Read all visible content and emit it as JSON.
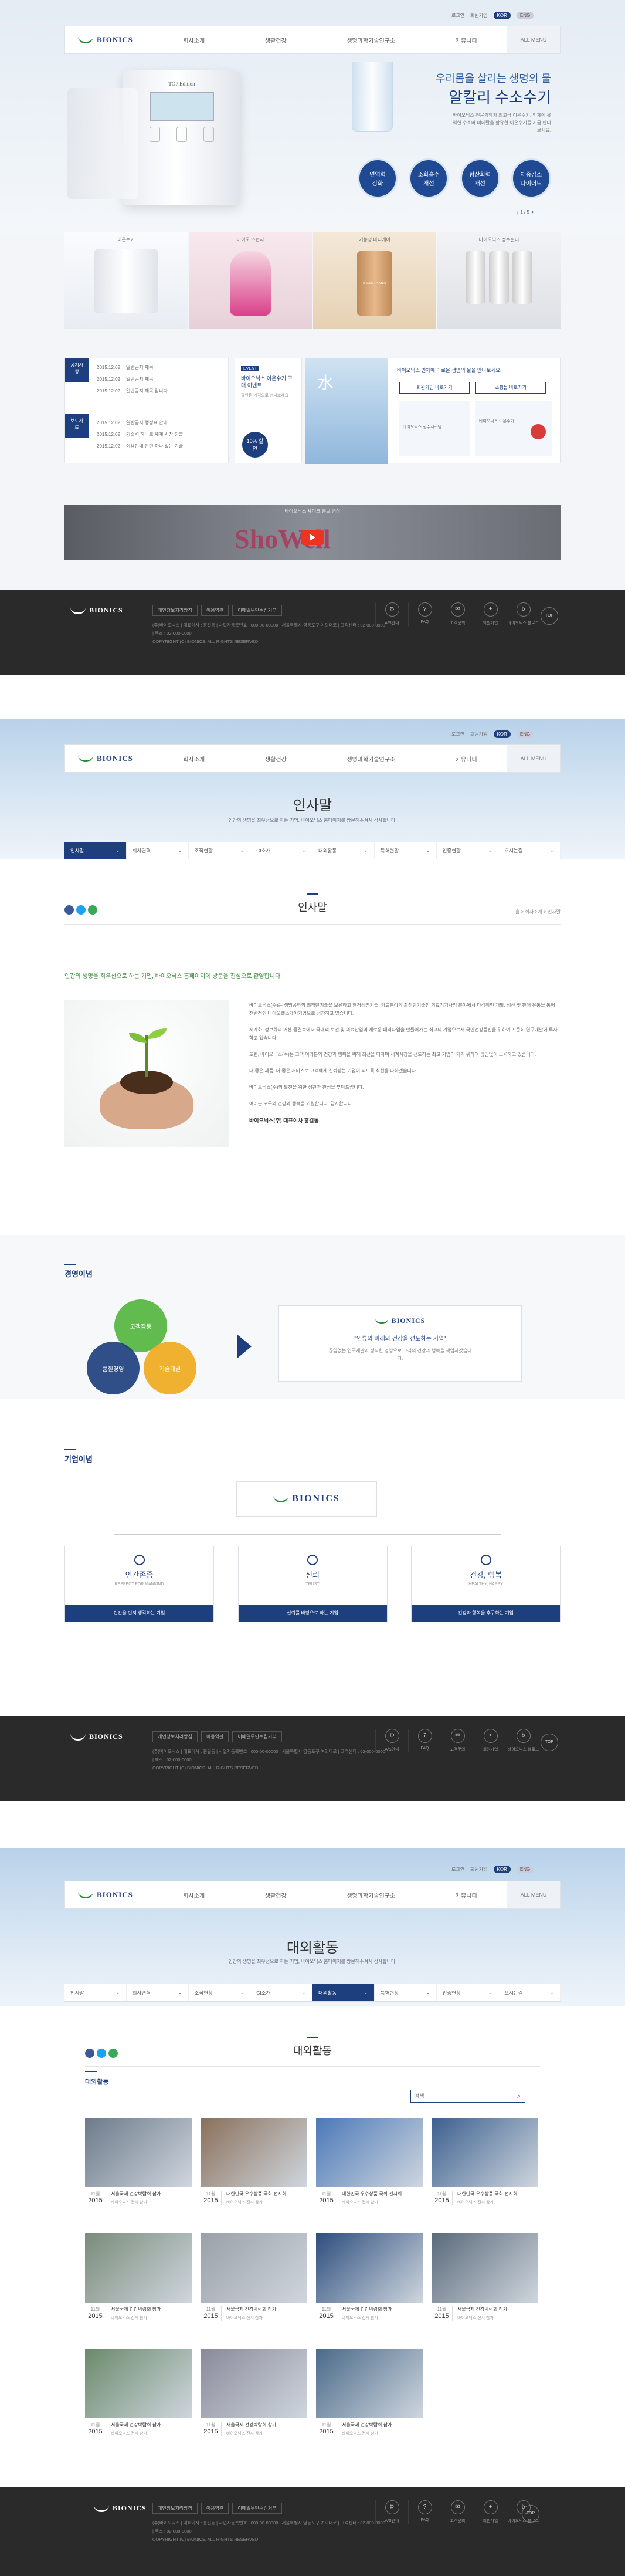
{
  "header": {
    "logo": "BIONICS",
    "nav": [
      "회사소개",
      "생활건강",
      "생명과학기술연구소",
      "커뮤니티"
    ],
    "all_menu": "ALL MENU",
    "util": [
      "로그인",
      "회원가입"
    ],
    "lang": [
      "KOR",
      "ENG"
    ]
  },
  "main": {
    "hero": {
      "tagline": "우리몸을 살리는 생명의 물",
      "title": "알칼리 수소수기",
      "desc": "바이오닉스 전문의학가 최고급 이온수기, 인체에 유익한 수소와 미네랄을 함유한 이온수기를 지금 만나보세요.",
      "device_label": "TOP Edition",
      "badges": [
        "면역력 강화",
        "소화흡수 개선",
        "항산화력 개선",
        "체중감소 다이어트"
      ],
      "pager": "1 / 5"
    },
    "products": [
      "이온수기",
      "바이오 스펀지",
      "기능성 바디케어",
      "바이오닉스 정수필터"
    ],
    "product_brand": "BEAUTAMIN",
    "notice": {
      "label1": "공지사항",
      "label2": "보도자료",
      "rows": [
        [
          "2015.12.02",
          "일반공지 제목"
        ],
        [
          "2015.12.02",
          "일반공지 제목"
        ],
        [
          "2015.12.02",
          "일반공지 제목 입니다"
        ],
        [
          "2015.12.02",
          "일반공지 행정표 안내"
        ],
        [
          "2015.12.02",
          "기술력 하나로 세계 시장 진출"
        ],
        [
          "2015.12.02",
          "이용안내 관련 하나 있는 기술"
        ]
      ]
    },
    "event": {
      "tag": "EVENT",
      "title": "바이오닉스 이온수기 구매 이벤트",
      "sub": "할인된 가격으로 만나보세요",
      "discount": "10% 할인"
    },
    "water": {
      "glyph": "水",
      "text": "바이오닉스 인체에 이로운 생명의 물을 만나보세요.",
      "btn1": "회원가입 바로가기",
      "btn2": "쇼핑몰 바로가기",
      "left_caption": "바이오닉스 정수시스템",
      "right_caption": "바이오닉스 이온수기"
    },
    "banner": {
      "caption": "바이오닉스 셰이크 홍보 영상",
      "brand": "ShoWell"
    }
  },
  "footer": {
    "logo": "BIONICS",
    "links": [
      "개인정보처리방침",
      "이용약관",
      "이메일무단수집거부"
    ],
    "address": "(주)바이오닉스 | 대표이사 : 홍길동 | 사업자등록번호 : 000-00-00000 | 서울특별시 영등포구 여의대로 | 고객센터 : 02-000-0000 | 팩스 : 02-000-0000",
    "copyright": "COPYRIGHT (C) BIONICS. ALL RIGHTS RESERVED.",
    "icons": [
      "A/S안내",
      "FAQ",
      "고객문의",
      "회원가입",
      "바이오닉스 블로그",
      "제품상담"
    ],
    "top": "TOP"
  },
  "greeting": {
    "title": "인사말",
    "sub": "인간의 생명을 최우선으로 하는 기업, 바이오닉스 홈페이지를 방문해주셔서 감사합니다.",
    "lnb": [
      "인사말",
      "회사연혁",
      "조직현황",
      "CI소개",
      "대외활동",
      "특허현황",
      "인증현황",
      "오시는길"
    ],
    "breadcrumb": "홈 > 회사소개 > 인사말",
    "intro": "인간의 생명을 최우선으로 하는 기업, 바이오닉스 홈페이지에 방문을 진심으로 환영합니다.",
    "paragraphs": [
      "바이오닉스(주)는 생명공학의 최첨단기술을 보유하고 환경생명기술, 의료분야의 최첨단기술인 의료기기사업 분야에서 다각적인 개발, 생산 및 판매 유통을 통해 전반적인 바이오헬스케어기업으로 성장하고 있습니다.",
      "세계화, 정보화의 거센 물결속에서 국내외 보건 및 의료산업의 새로운 패러다임을 만들어가는 최고의 기업으로서 국민건강증진을 위하여 꾸준히 연구개발에 투자하고 있습니다.",
      "또한, 바이오닉스(주)는 고객 여러분의 건강과 행복을 위해 최선을 다하며 세계시장을 선도하는 최고 기업이 되기 위하여 끊임없이 노력하고 있습니다.",
      "더 좋은 제품, 더 좋은 서비스로 고객에게 신뢰받는 기업이 되도록 최선을 다하겠습니다.",
      "바이오닉스(주)의 발전을 위한 성원과 관심을 부탁드립니다.",
      "여러분 모두의 건강과 행복을 기원합니다. 감사합니다."
    ],
    "signature": "바이오닉스(주) 대표이사 홍길동",
    "philosophy": {
      "title": "경영이념",
      "circles": [
        "고객감동",
        "품질경영",
        "기술개발"
      ],
      "box_logo": "BIONICS",
      "box_quote": "\"인류의 미래와 건강을 선도하는 기업\"",
      "box_text": "끊임없는 연구개발과 정직한 경영으로 고객의 건강과 행복을 책임지겠습니다."
    },
    "ideal": {
      "title": "기업이념",
      "logo": "BIONICS",
      "cards": [
        {
          "icon": "person-icon",
          "title": "인간존중",
          "en": "RESPECT FOR MANKIND",
          "btn": "인간을 먼저 생각하는 기업"
        },
        {
          "icon": "globe-icon",
          "title": "신뢰",
          "en": "TRUST",
          "btn": "신뢰를 바탕으로 하는 기업"
        },
        {
          "icon": "smile-icon",
          "title": "건강, 행복",
          "en": "HEALTHY, HAPPY",
          "btn": "건강과 행복을 추구하는 기업"
        }
      ]
    }
  },
  "activities": {
    "title": "대외활동",
    "sub": "인간의 생명을 최우선으로 하는 기업, 바이오닉스 홈페이지를 방문해주셔서 감사합니다.",
    "section_title": "대외활동",
    "search_placeholder": "검색",
    "items": [
      {
        "date": "11월",
        "year": "2015",
        "title": "서울국제 건강박람회 참가",
        "desc": "바이오닉스 전시 참가"
      },
      {
        "date": "11월",
        "year": "2015",
        "title": "대한민국 우수상품 국회 전시회",
        "desc": "바이오닉스 전시 참가"
      },
      {
        "date": "11월",
        "year": "2015",
        "title": "대한민국 우수상품 국회 전시회",
        "desc": "바이오닉스 전시 참가"
      },
      {
        "date": "11월",
        "year": "2015",
        "title": "대한민국 우수상품 국회 전시회",
        "desc": "바이오닉스 전시 참가"
      },
      {
        "date": "11월",
        "year": "2015",
        "title": "서울국제 건강박람회 참가",
        "desc": "바이오닉스 전시 참가"
      },
      {
        "date": "11월",
        "year": "2015",
        "title": "서울국제 건강박람회 참가",
        "desc": "바이오닉스 전시 참가"
      },
      {
        "date": "11월",
        "year": "2015",
        "title": "서울국제 건강박람회 참가",
        "desc": "바이오닉스 전시 참가"
      },
      {
        "date": "11월",
        "year": "2015",
        "title": "서울국제 건강박람회 참가",
        "desc": "바이오닉스 전시 참가"
      },
      {
        "date": "11월",
        "year": "2015",
        "title": "서울국제 건강박람회 참가",
        "desc": "바이오닉스 전시 참가"
      },
      {
        "date": "11월",
        "year": "2015",
        "title": "서울국제 건강박람회 참가",
        "desc": "바이오닉스 전시 참가"
      },
      {
        "date": "11월",
        "year": "2015",
        "title": "서울국제 건강박람회 참가",
        "desc": "바이오닉스 전시 참가"
      }
    ]
  }
}
